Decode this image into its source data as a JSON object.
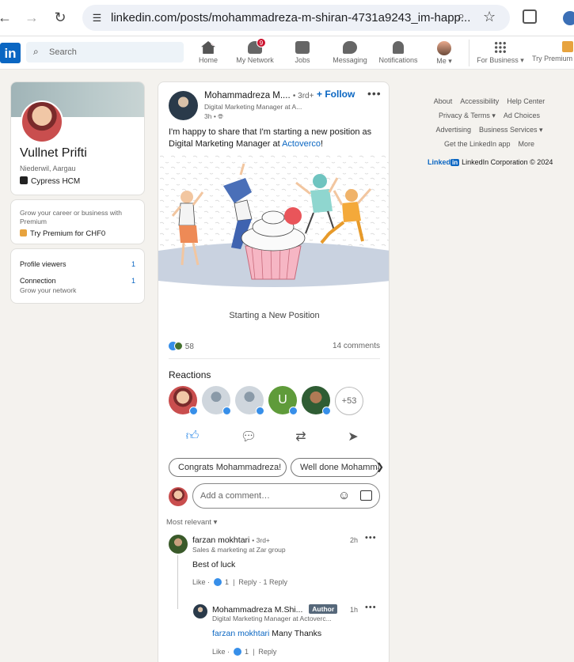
{
  "browser": {
    "url": "linkedin.com/posts/mohammadreza-m-shiran-4731a9243_im-happ..."
  },
  "nav": {
    "logo": "in",
    "search_placeholder": "Search",
    "items": [
      {
        "label": "Home",
        "icon": "home-icon"
      },
      {
        "label": "My Network",
        "icon": "network-icon",
        "badge": "9"
      },
      {
        "label": "Jobs",
        "icon": "briefcase-icon"
      },
      {
        "label": "Messaging",
        "icon": "message-icon"
      },
      {
        "label": "Notifications",
        "icon": "bell-icon"
      },
      {
        "label": "Me ▾",
        "icon": "avatar"
      },
      {
        "label": "For Business ▾",
        "icon": "grid-icon"
      },
      {
        "label": "Try Premium",
        "icon": "premium-icon"
      }
    ]
  },
  "profile": {
    "name": "Vullnet Prifti",
    "location": "Niederwil, Aargau",
    "company": "Cypress HCM",
    "premium_text": "Grow your career or business with Premium",
    "premium_link": "Try Premium for CHF0",
    "stats": [
      {
        "label": "Profile viewers",
        "value": "1"
      },
      {
        "label": "Connection",
        "sub": "Grow your network",
        "value": "1"
      }
    ]
  },
  "post": {
    "author_name": "Mohammadreza M....",
    "author_degree": "• 3rd+",
    "follow": "+ Follow",
    "author_headline": "Digital Marketing Manager at A...",
    "time": "3h •",
    "text_before": "I'm happy to share that I'm starting a new position as Digital Marketing Manager at ",
    "text_link": "Actoverco",
    "text_after": "!",
    "caption": "Starting a New Position",
    "reaction_count": "58",
    "comments_count": "14 comments",
    "reactions_title": "Reactions",
    "reactors_more": "+53",
    "reactor_initial": "U",
    "actions": [
      "Like",
      "Comment",
      "Repost",
      "Send"
    ],
    "chips": [
      "Congrats Mohammadreza!",
      "Well done Mohammadreza"
    ],
    "comment_placeholder": "Add a comment…",
    "sort_label": "Most relevant ▾"
  },
  "comments": [
    {
      "name": "farzan mokhtari",
      "degree": "• 3rd+",
      "headline": "Sales & marketing at Zar group",
      "time": "2h",
      "body": "Best of luck",
      "like_label": "Like ·",
      "like_count": "1",
      "reply_label": "Reply ·",
      "replies": "1 Reply"
    },
    {
      "name": "Mohammadreza M.Shi...",
      "author_tag": "Author",
      "headline": "Digital Marketing Manager at Actoverc...",
      "time": "1h",
      "mention": "farzan mokhtari",
      "body": " Many Thanks",
      "like_label": "Like ·",
      "like_count": "1",
      "reply_label": "Reply"
    }
  ],
  "footer": {
    "links": [
      "About",
      "Accessibility",
      "Help Center",
      "Privacy & Terms ▾",
      "Ad Choices",
      "Advertising",
      "Business Services ▾",
      "Get the LinkedIn app",
      "More"
    ],
    "brand": "Linked",
    "brand_in": "in",
    "copyright": "LinkedIn Corporation © 2024"
  },
  "colors": {
    "linkedin_blue": "#0a66c2",
    "page_bg": "#f4f2ee",
    "notification_red": "#cb112d"
  }
}
